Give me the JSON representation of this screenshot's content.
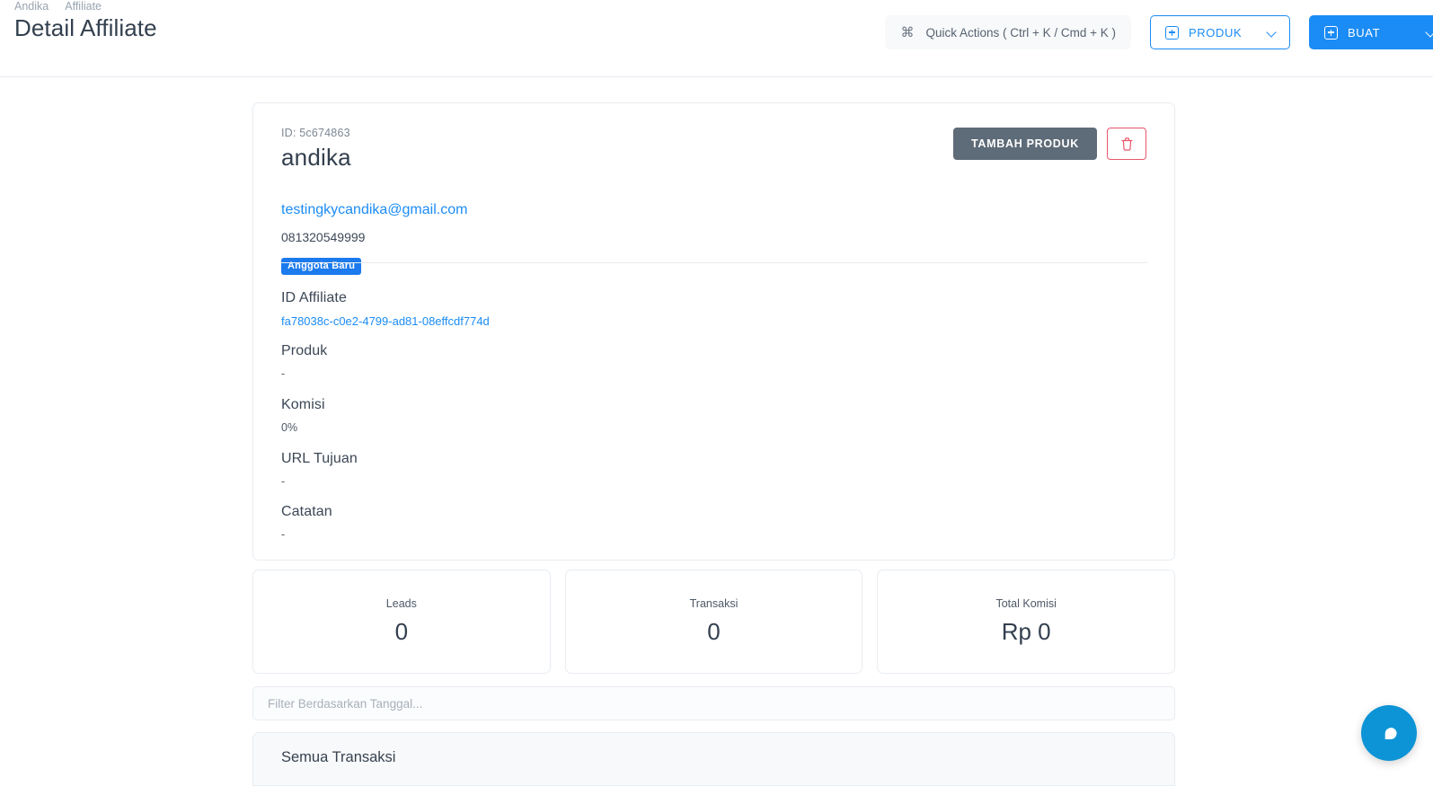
{
  "header": {
    "breadcrumb": [
      "Andika",
      "Affiliate"
    ],
    "title": "Detail Affiliate",
    "quick_actions_label": "Quick Actions ( Ctrl + K / Cmd + K )",
    "cmd_glyph": "⌘",
    "produk_button": "PRODUK",
    "buat_button": "BUAT"
  },
  "detail": {
    "id_line": "ID: 5c674863",
    "name": "andika",
    "email": "testingkycandika@gmail.com",
    "phone": "081320549999",
    "badge": "Anggota Baru",
    "add_product_button": "TAMBAH PRODUK",
    "fields": [
      {
        "label": "ID Affiliate",
        "value": "fa78038c-c0e2-4799-ad81-08effcdf774d"
      },
      {
        "label": "Produk",
        "value": "-"
      },
      {
        "label": "Komisi",
        "value": "0%"
      },
      {
        "label": "URL Tujuan",
        "value": "-"
      },
      {
        "label": "Catatan",
        "value": "-"
      }
    ]
  },
  "stats": [
    {
      "label": "Leads",
      "value": "0"
    },
    {
      "label": "Transaksi",
      "value": "0"
    },
    {
      "label": "Total Komisi",
      "value": "Rp 0"
    }
  ],
  "filter": {
    "value": "",
    "placeholder": "Filter Berdasarkan Tanggal..."
  },
  "transactions": {
    "title": "Semua Transaksi"
  },
  "colors": {
    "accent": "#1b8cf5",
    "badge": "#1b7aed",
    "danger": "#e8566b",
    "gray_button": "#5e6b78",
    "chat": "#0d94d6"
  }
}
